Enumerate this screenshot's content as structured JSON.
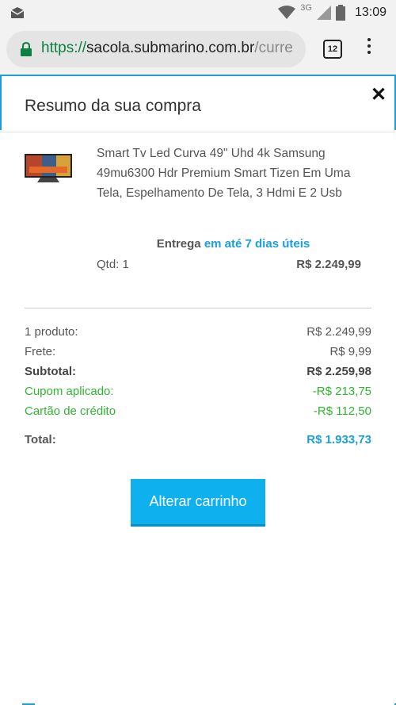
{
  "status_bar": {
    "network": "3G",
    "time": "13:09"
  },
  "browser": {
    "url_scheme": "https://",
    "url_host": "sacola.submarino.com.br",
    "url_path": "/curre",
    "tab_count": "12"
  },
  "modal": {
    "title": "Resumo da sua compra",
    "product": {
      "name": "Smart Tv Led Curva 49\" Uhd 4k Samsung 49mu6300 Hdr Premium Smart Tizen Em Uma Tela, Espelhamento De Tela, 3 Hdmi E 2 Usb",
      "delivery_label": "Entrega",
      "delivery_time": "em até 7 dias úteis",
      "qty": "Qtd: 1",
      "price": "R$ 2.249,99"
    },
    "summary": [
      {
        "label": "1 produto:",
        "value": "R$ 2.249,99"
      },
      {
        "label": "Frete:",
        "value": "R$ 9,99"
      },
      {
        "label": "Subtotal:",
        "value": "R$ 2.259,98"
      },
      {
        "label": "Cupom aplicado:",
        "value": "-R$ 213,75"
      },
      {
        "label": "Cartão de crédito",
        "value": "-R$ 112,50"
      },
      {
        "label": "Total:",
        "value": "R$ 1.933,73"
      }
    ],
    "button_label": "Alterar carrinho"
  },
  "colors": {
    "accent": "#1a9fd8",
    "button": "#0fb0ee",
    "discount": "#2fb52f"
  }
}
